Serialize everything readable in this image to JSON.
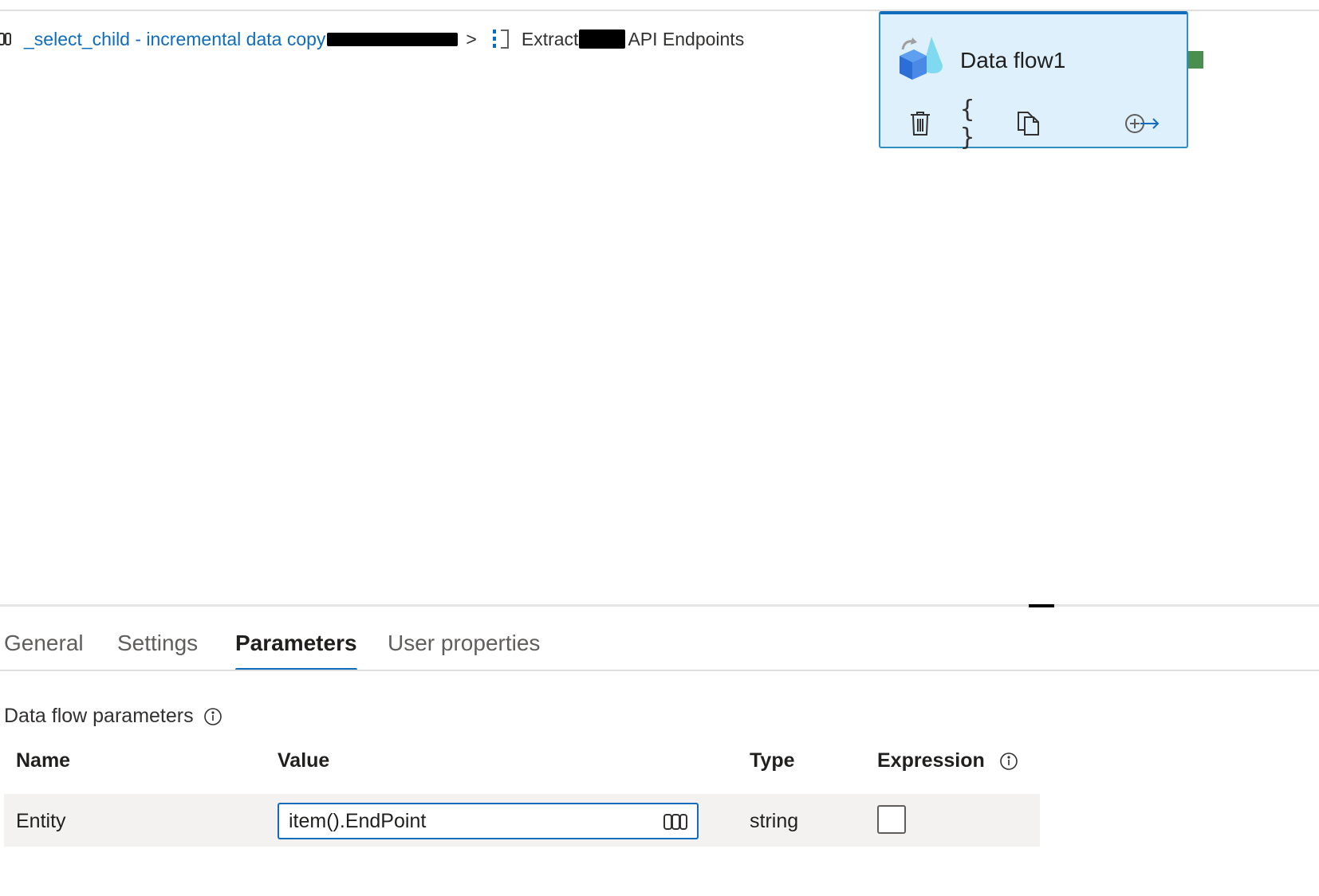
{
  "breadcrumb": {
    "pipeline": "_select_child - incremental data copy",
    "separator": ">",
    "current_prefix": "Extract",
    "current_suffix": "API Endpoints"
  },
  "activity": {
    "title": "Data flow1",
    "actions": [
      "delete-icon",
      "code-icon",
      "copy-icon",
      "add-output-icon"
    ],
    "code_glyph": "{ }",
    "border_color": "#2f8fbd",
    "fill_color": "#def0fb",
    "success_port_color": "#4b8f50"
  },
  "panel": {
    "tabs": [
      {
        "label": "General"
      },
      {
        "label": "Settings"
      },
      {
        "label": "Parameters"
      },
      {
        "label": "User properties"
      }
    ],
    "active_tab": "Parameters",
    "section_title": "Data flow parameters",
    "columns": {
      "name": "Name",
      "value": "Value",
      "type": "Type",
      "expression": "Expression"
    },
    "rows": [
      {
        "name": "Entity",
        "value": "item().EndPoint",
        "type": "string",
        "expression": false
      }
    ]
  },
  "colors": {
    "accent": "#0f6cbd",
    "text": "#323130",
    "row_bg": "#f3f2f1"
  }
}
